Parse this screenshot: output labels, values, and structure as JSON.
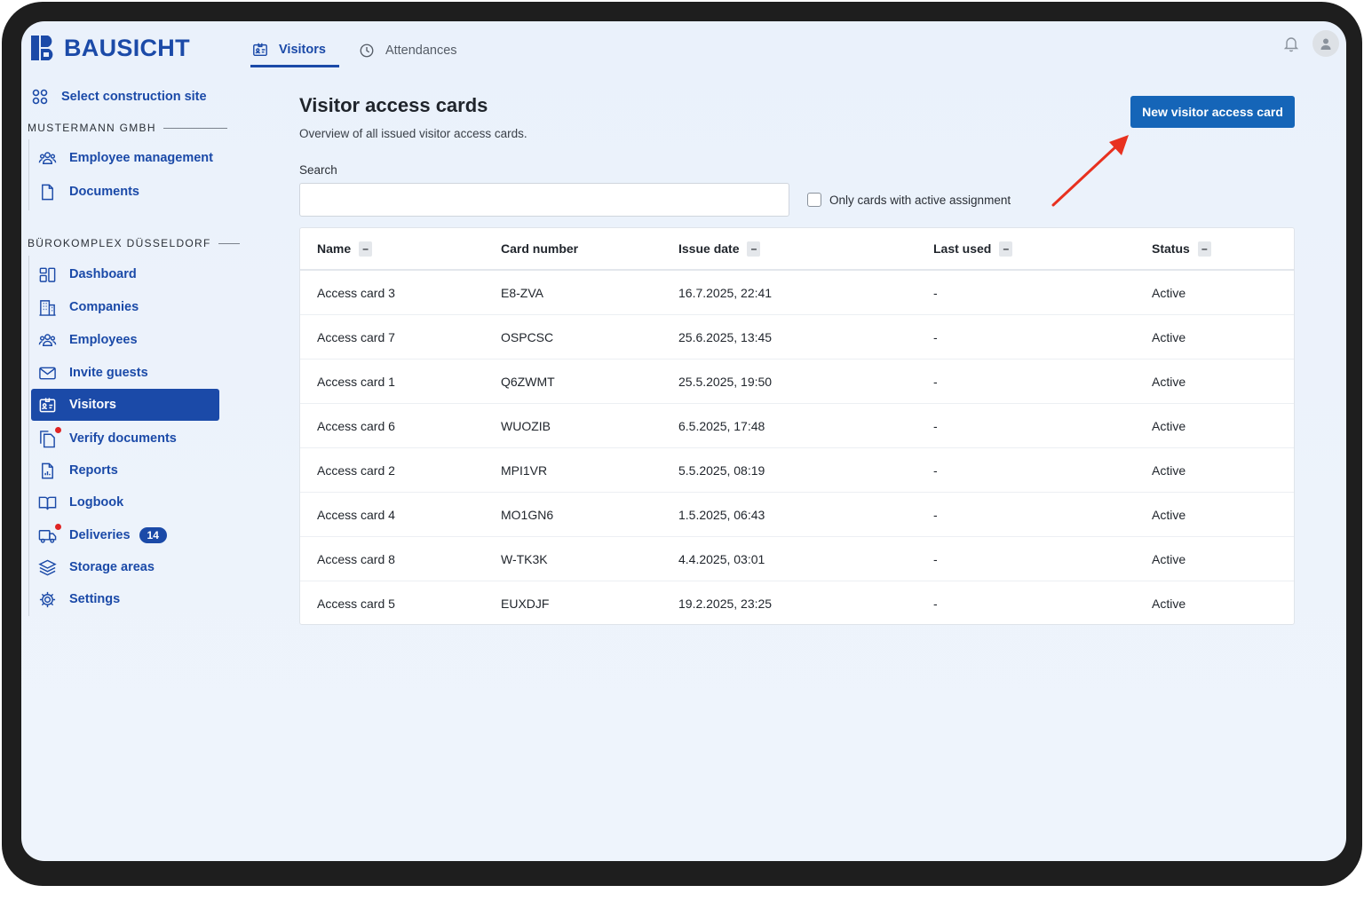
{
  "brand": {
    "name": "BAUSICHT",
    "color": "#1b4aa8"
  },
  "tabs": [
    {
      "label": "Visitors",
      "icon": "id-card-icon",
      "active": true
    },
    {
      "label": "Attendances",
      "icon": "clock-icon",
      "active": false
    }
  ],
  "header_icons": [
    "bell-icon",
    "user-avatar-icon"
  ],
  "sidebar": {
    "select_site": "Select construction site",
    "company_section": "MUSTERMANN GMBH",
    "company_items": [
      {
        "label": "Employee management",
        "icon": "people-icon"
      },
      {
        "label": "Documents",
        "icon": "document-icon"
      }
    ],
    "site_section": "BÜROKOMPLEX DÜSSELDORF",
    "site_items": [
      {
        "label": "Dashboard",
        "icon": "dashboard-icon"
      },
      {
        "label": "Companies",
        "icon": "building-icon"
      },
      {
        "label": "Employees",
        "icon": "people-icon"
      },
      {
        "label": "Invite guests",
        "icon": "envelope-icon"
      },
      {
        "label": "Visitors",
        "icon": "id-card-icon",
        "active": true
      },
      {
        "label": "Verify documents",
        "icon": "documents-icon",
        "notification_dot": true
      },
      {
        "label": "Reports",
        "icon": "report-icon"
      },
      {
        "label": "Logbook",
        "icon": "book-icon"
      },
      {
        "label": "Deliveries",
        "icon": "truck-icon",
        "notification_dot": true,
        "badge": "14"
      },
      {
        "label": "Storage areas",
        "icon": "layers-icon"
      },
      {
        "label": "Settings",
        "icon": "gear-icon"
      }
    ]
  },
  "main": {
    "title": "Visitor access cards",
    "subtitle": "Overview of all issued visitor access cards.",
    "new_button": "New visitor access card",
    "search_label": "Search",
    "search_value": "",
    "checkbox_label": "Only cards with active assignment",
    "checkbox_checked": false,
    "table": {
      "columns": [
        {
          "label": "Name",
          "sortable": true,
          "sort_symbol": "–"
        },
        {
          "label": "Card number",
          "sortable": false
        },
        {
          "label": "Issue date",
          "sortable": true,
          "sort_symbol": "–"
        },
        {
          "label": "Last used",
          "sortable": true,
          "sort_symbol": "–"
        },
        {
          "label": "Status",
          "sortable": true,
          "sort_symbol": "–"
        }
      ],
      "rows": [
        [
          "Access card 3",
          "E8-ZVA",
          "16.7.2025, 22:41",
          "-",
          "Active"
        ],
        [
          "Access card 7",
          "OSPCSC",
          "25.6.2025, 13:45",
          "-",
          "Active"
        ],
        [
          "Access card 1",
          "Q6ZWMT",
          "25.5.2025, 19:50",
          "-",
          "Active"
        ],
        [
          "Access card 6",
          "WUOZIB",
          "6.5.2025, 17:48",
          "-",
          "Active"
        ],
        [
          "Access card 2",
          "MPI1VR",
          "5.5.2025, 08:19",
          "-",
          "Active"
        ],
        [
          "Access card 4",
          "MO1GN6",
          "1.5.2025, 06:43",
          "-",
          "Active"
        ],
        [
          "Access card 8",
          "W-TK3K",
          "4.4.2025, 03:01",
          "-",
          "Active"
        ],
        [
          "Access card 5",
          "EUXDJF",
          "19.2.2025, 23:25",
          "-",
          "Active"
        ]
      ]
    }
  },
  "annotation": {
    "type": "arrow",
    "color": "#e8311f",
    "points_to": "new-visitor-card-button"
  }
}
